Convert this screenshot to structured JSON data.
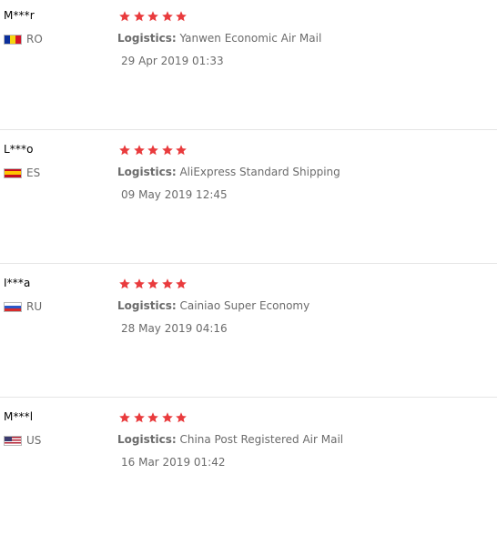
{
  "logistics_label": "Logistics:",
  "rating_max": 5,
  "star_color": "#e93b3d",
  "reviews": [
    {
      "user": "M***r",
      "country": "RO",
      "flag_colors": [
        "#0b2f9c",
        "#f6d510",
        "#d4152a"
      ],
      "rating": 5,
      "logistics": "Yanwen Economic Air Mail",
      "date": "29 Apr 2019 01:33"
    },
    {
      "user": "L***o",
      "country": "ES",
      "flag_colors": [
        "#c60b1e",
        "#ffc400",
        "#c60b1e"
      ],
      "rating": 5,
      "logistics": "AliExpress Standard Shipping",
      "date": "09 May 2019 12:45"
    },
    {
      "user": "I***a",
      "country": "RU",
      "flag_colors": [
        "#ffffff",
        "#2b57c7",
        "#d72b2b"
      ],
      "rating": 5,
      "logistics": "Cainiao Super Economy",
      "date": "28 May 2019 04:16"
    },
    {
      "user": "M***l",
      "country": "US",
      "flag_colors": [
        "#b22234",
        "#ffffff",
        "#3c3b6e"
      ],
      "rating": 5,
      "logistics": "China Post Registered Air Mail",
      "date": "16 Mar 2019 01:42"
    }
  ]
}
